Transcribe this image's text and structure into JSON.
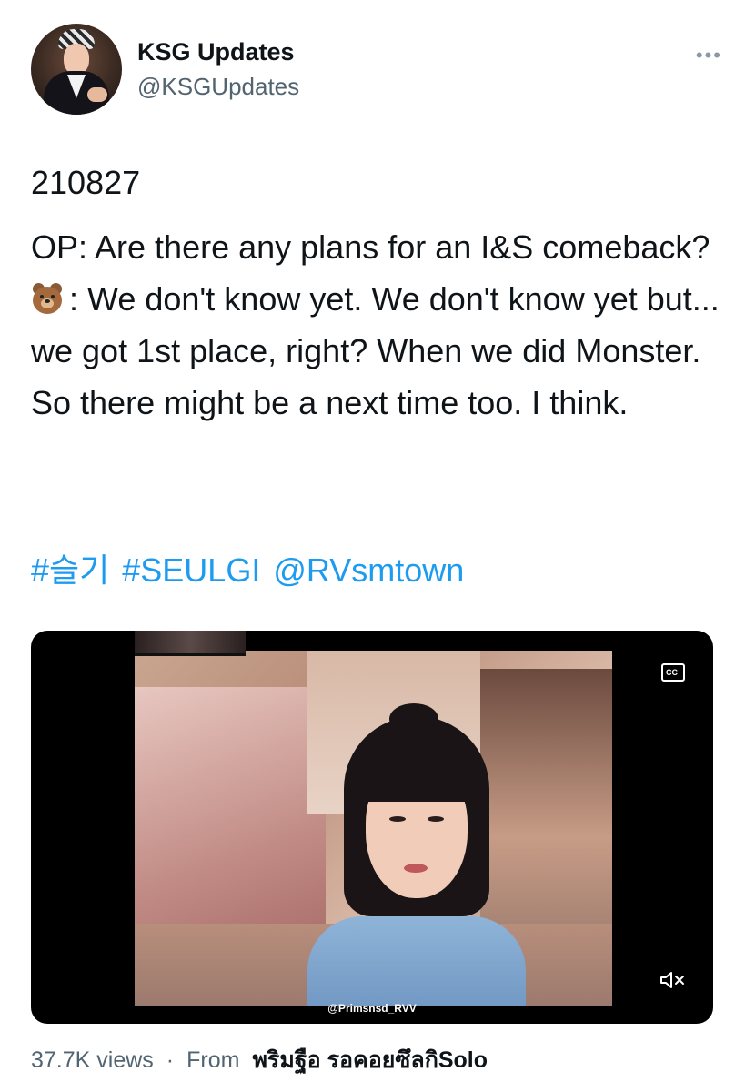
{
  "author": {
    "name": "KSG Updates",
    "handle": "@KSGUpdates",
    "more_icon": "more-horizontal-icon"
  },
  "tweet": {
    "date": "210827",
    "question": "OP: Are there any plans for an I&S comeback?",
    "answer_emoji": "bear-face-emoji",
    "answer": ": We don't know yet. We don't know yet but... we got 1st place, right? When we did Monster. So there might be a next time too. I think.",
    "hashtags": [
      "#슬기",
      "#SEULGI",
      "@RVsmtown"
    ]
  },
  "media": {
    "watermark": "@Primsnsd_RVV",
    "caption_icon": "closed-captions-icon",
    "mute_icon": "muted-speaker-icon"
  },
  "footer": {
    "views": "37.7K views",
    "separator": "·",
    "from_label": "From",
    "source": "พริมฐือ รอคอยซึลกิSolo"
  },
  "colors": {
    "link": "#1d9bf0",
    "secondary_text": "#536471",
    "primary_text": "#0f1419"
  }
}
